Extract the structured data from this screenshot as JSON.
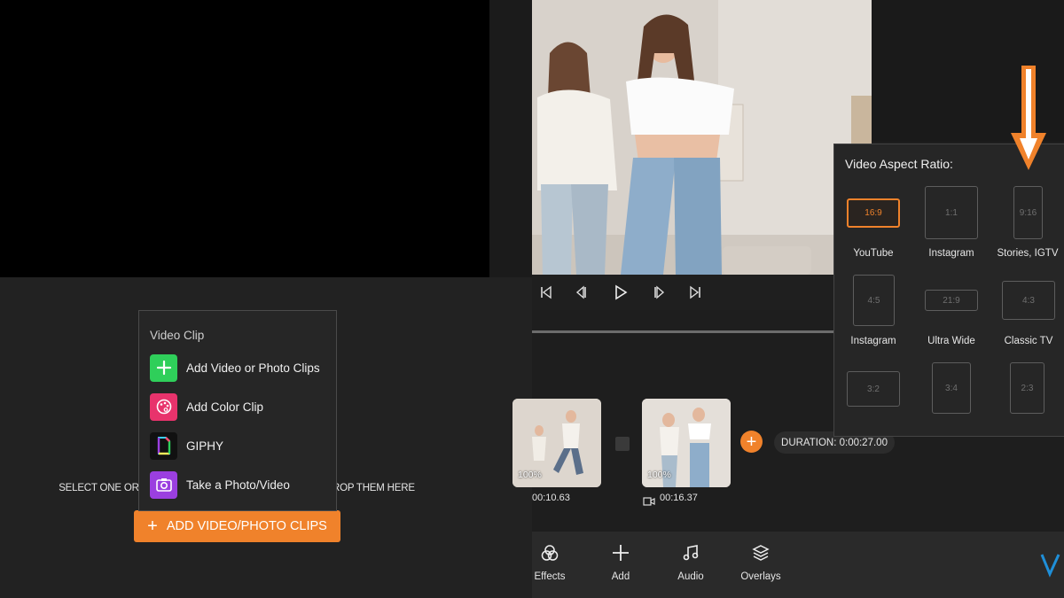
{
  "left": {
    "drop_hint": "SELECT ONE OR MORE                                                      O DROP THEM HERE",
    "add_button_label": "ADD VIDEO/PHOTO CLIPS",
    "menu": {
      "title": "Video Clip",
      "items": [
        {
          "label": "Add Video or Photo Clips",
          "icon": "plus-icon",
          "color": "#2fcf5a"
        },
        {
          "label": "Add Color Clip",
          "icon": "palette-icon",
          "color": "#e8336c"
        },
        {
          "label": "GIPHY",
          "icon": "giphy-icon",
          "color": "#111111"
        },
        {
          "label": "Take a Photo/Video",
          "icon": "camera-icon",
          "color": "#9b3fe0"
        }
      ]
    }
  },
  "right": {
    "clips": [
      {
        "volume": "100%",
        "time": "00:10.63"
      },
      {
        "volume": "100%",
        "time": "00:16.37"
      }
    ],
    "duration": "DURATION: 0:00:27.00",
    "toolbar": [
      {
        "label": "Effects",
        "icon": "effects-icon"
      },
      {
        "label": "Add",
        "icon": "plus-icon"
      },
      {
        "label": "Audio",
        "icon": "music-icon"
      },
      {
        "label": "Overlays",
        "icon": "layers-icon"
      }
    ]
  },
  "aspect": {
    "title": "Video Aspect Ratio:",
    "options": [
      {
        "ratio": "16:9",
        "label": "YouTube",
        "selected": true
      },
      {
        "ratio": "1:1",
        "label": "Instagram"
      },
      {
        "ratio": "9:16",
        "label": "Stories, IGTV"
      },
      {
        "ratio": "4:5",
        "label": "Instagram"
      },
      {
        "ratio": "21:9",
        "label": "Ultra Wide"
      },
      {
        "ratio": "4:3",
        "label": "Classic TV"
      },
      {
        "ratio": "3:2",
        "label": ""
      },
      {
        "ratio": "3:4",
        "label": ""
      },
      {
        "ratio": "2:3",
        "label": ""
      }
    ]
  },
  "colors": {
    "accent": "#f0822b"
  }
}
